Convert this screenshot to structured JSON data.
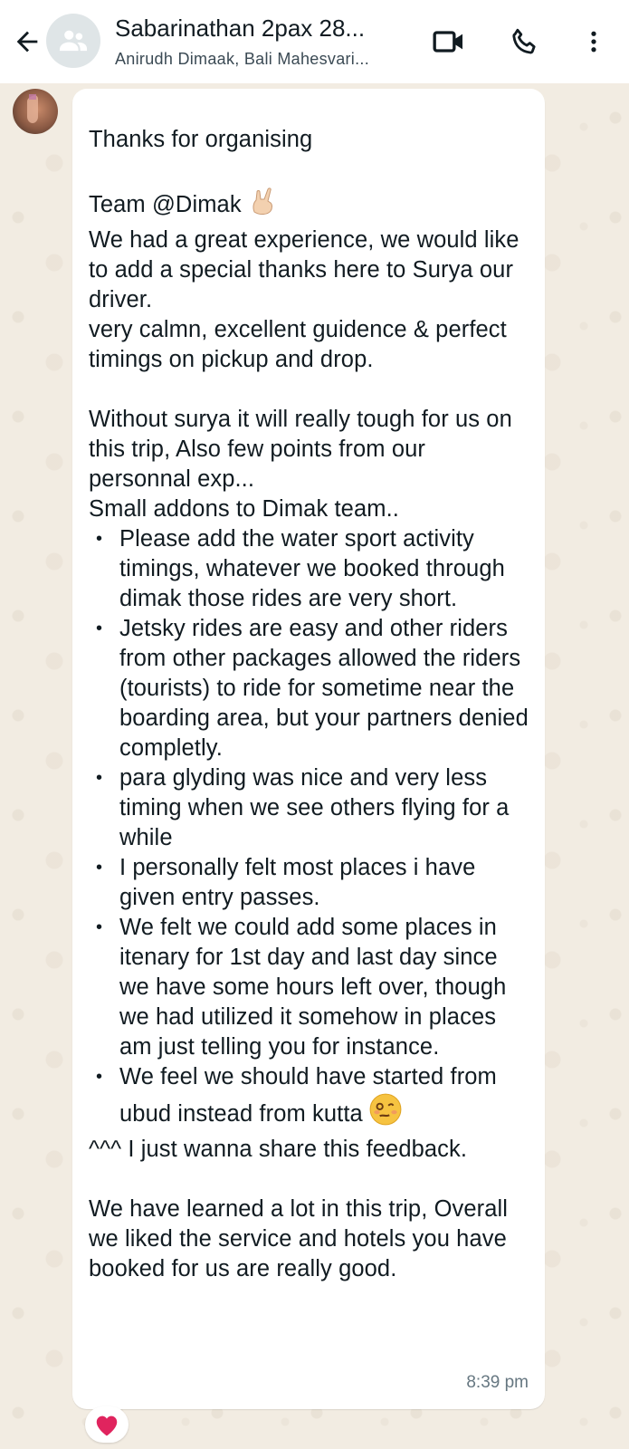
{
  "header": {
    "title": "Sabarinathan 2pax 28...",
    "subtitle": "Anirudh Dimaak, Bali Mahesvari..."
  },
  "icons": {
    "back": "arrow-left-icon",
    "group_avatar": "group-icon",
    "video_call": "video-camera-icon",
    "voice_call": "phone-icon",
    "menu": "more-vertical-icon",
    "emoji_rock": "rock-hand-emoji",
    "emoji_dizzy": "woozy-face-emoji",
    "reaction": "red-heart-emoji"
  },
  "message": {
    "line1": "Thanks for organising",
    "team_line": "Team @Dimak",
    "para1": "We had a great experience, we would like to add a special thanks here to Surya our driver.",
    "para2": "very calmn, excellent guidence & perfect timings on pickup and drop.",
    "para3": "Without surya it will really tough for us on this trip, Also few points from our personnal exp...",
    "para4": "Small addons to Dimak team..",
    "bullets": [
      "Please add the water sport activity timings, whatever we booked through dimak those rides are very short.",
      "Jetsky rides are easy and other riders from other packages allowed the riders (tourists) to ride for sometime near the boarding area, but your partners denied completly.",
      "para glyding was nice and very less timing when we see others flying for a while",
      "I personally felt most places i have given entry passes.",
      "We felt we could add some places in itenary for 1st day and last day since we have some hours left over, though we had utilized it somehow in places am just telling you for instance.",
      "We feel we should have started from ubud instead from kutta"
    ],
    "para5": "^^^ I just wanna share this feedback.",
    "para6": "We have learned a lot in this trip, Overall we liked the service and hotels you have booked for us are really good.",
    "time": "8:39 pm"
  },
  "colors": {
    "header_bg": "#ffffff",
    "chat_bg": "#f2ece2",
    "bubble_bg": "#ffffff",
    "text": "#111b21",
    "muted": "#667781",
    "heart": "#e0245e"
  }
}
